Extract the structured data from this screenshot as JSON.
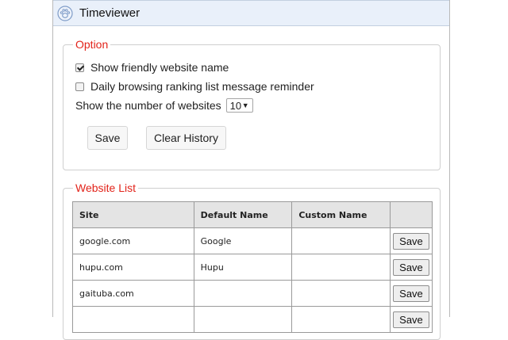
{
  "window": {
    "title": "Timeviewer",
    "icon": "paw-icon"
  },
  "option": {
    "legend": "Option",
    "show_friendly_name": {
      "label": "Show friendly website name",
      "checked": true
    },
    "daily_reminder": {
      "label": "Daily browsing ranking list message reminder",
      "checked": false
    },
    "num_websites": {
      "label": "Show the number of websites",
      "value": "10"
    },
    "save_label": "Save",
    "clear_label": "Clear History"
  },
  "website_list": {
    "legend": "Website List",
    "headers": {
      "site": "Site",
      "default_name": "Default Name",
      "custom_name": "Custom Name",
      "action": ""
    },
    "rows": [
      {
        "site": "google.com",
        "default_name": "Google",
        "custom_name": "",
        "save_label": "Save"
      },
      {
        "site": "hupu.com",
        "default_name": "Hupu",
        "custom_name": "",
        "save_label": "Save"
      },
      {
        "site": "gaituba.com",
        "default_name": "",
        "custom_name": "",
        "save_label": "Save"
      },
      {
        "site": "",
        "default_name": "",
        "custom_name": "",
        "save_label": "Save"
      }
    ]
  },
  "colors": {
    "legend": "#e2231a",
    "titlebar": "#e9f0fa",
    "table_header": "#e4e4e4"
  }
}
